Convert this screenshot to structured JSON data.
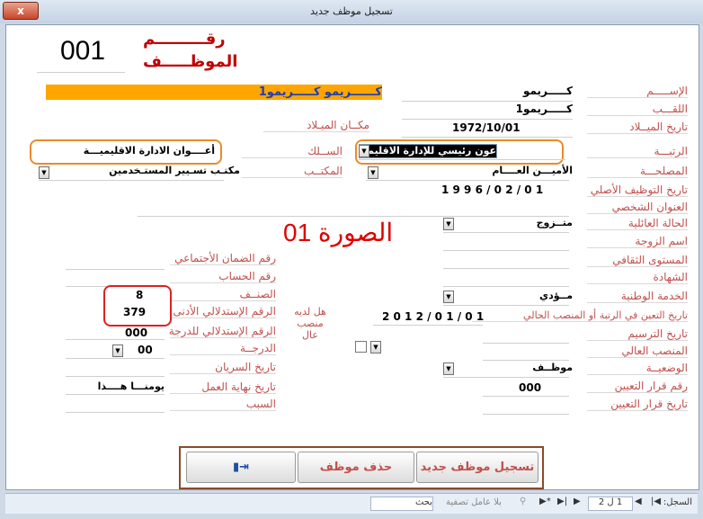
{
  "window": {
    "title": "تسجيل موظف جديد",
    "close_glyph": "x"
  },
  "employee": {
    "number": "001",
    "number_label_1": "رقـــــــــم",
    "number_label_2": "الموظـــــف"
  },
  "labels": {
    "name": "الإســـــم",
    "surname": "اللقـــب",
    "birth_date": "تاريخ الميــلاد",
    "birth_place": "مكــان الميـلاد",
    "rank": "الرتبـــة",
    "corps": "الســلك",
    "service": "المصلحـــة",
    "office": "المكتــب",
    "original_hire_date": "تاريخ التوظيف الأصلي",
    "personal_address": "العنوان الشخصي",
    "marital_status": "الحالة العائلية",
    "spouse_name": "اسم الزوجة",
    "education_level": "المستوى الثقافي",
    "diploma": "الشهادة",
    "national_service": "الخدمة الوطنية",
    "appointment_date": "تاريخ التعين في الرتبة أو المنصب الحالي",
    "tenure_date": "تاريخ الترسيم",
    "senior_post": "المنصب العالي",
    "status": "الوضعيــة",
    "appointment_decision_no": "رقم قرار التعيين",
    "appointment_decision_date": "تاريخ قرار التعيين",
    "social_security_no": "رقم الضمان الأجتماعي",
    "account_no": "رقم الحساب",
    "category": "الصنــف",
    "min_index": "الرقم الإستدلالي الأدنى",
    "grade_index": "الرقم الإستدلالي للدرجة",
    "grade": "الدرجــة",
    "effective_date": "تاريخ السريان",
    "end_of_work_date": "تاريخ نهاية العمل",
    "reason": "السبب",
    "has_senior_post": "هل لديه منصب عال",
    "photo": "الصورة 01"
  },
  "values": {
    "name": "كـــــريمو",
    "fullname_banner": "كــــــريمو كـــــريمو1",
    "surname": "كـــــريمو1",
    "birth_date": "1972/10/01",
    "rank": "عون رئيسي للإدارة الاقليمية",
    "corps": "أعــــوان الادارة الاقليميـــة",
    "service": "الأميـــن العــــام",
    "office": "مكتـب تسـيير المستـخدمين",
    "original_hire_date": "1 9 9 6 / 0 2 / 0 1",
    "marital_status": "متــزوج",
    "national_service": "مــؤدي",
    "appointment_date": "2 0 1 2 / 0 1 / 0 1",
    "status": "موظــف",
    "appointment_decision_no": "000",
    "category": "8",
    "min_index": "379",
    "grade_index": "000",
    "grade": "00",
    "end_of_work_date": "يومنـــا هــــذا"
  },
  "buttons": {
    "register": "تسجيل موظف جديد",
    "delete": "حذف موظف",
    "exit_icon": "door-exit-icon"
  },
  "statusbar": {
    "record_label": "السجل:",
    "record_pos": "1 ل 2",
    "no_filter": "بلا عامل تصفية",
    "search": "بحث"
  },
  "colors": {
    "accent_red": "#c00000",
    "label_red": "#c0504d",
    "banner_orange": "#ffa500",
    "highlight_orange": "#e98b2a",
    "frame_brown": "#8b4a2b"
  }
}
